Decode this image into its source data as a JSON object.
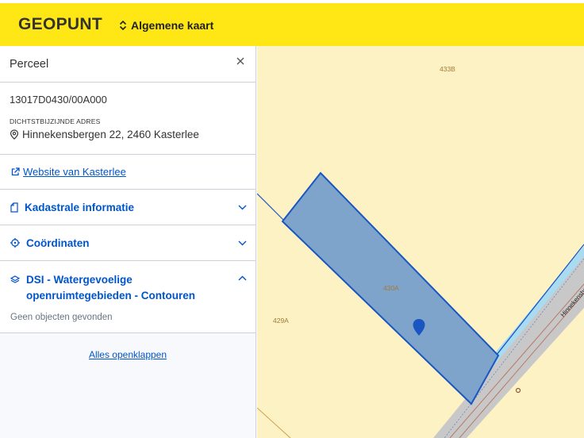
{
  "header": {
    "logo": "GEOPUNT",
    "map_type": "Algemene kaart"
  },
  "panel": {
    "title": "Perceel",
    "parcel_id": "13017D0430/00A000",
    "address_label": "DICHTSTBIJZIJNDE ADRES",
    "address": "Hinnekensbergen 22, 2460 Kasterlee",
    "website_link": "Website van Kasterlee",
    "sections": [
      {
        "label": "Kadastrale informatie",
        "icon": "document-icon",
        "expanded": false
      },
      {
        "label": "Coördinaten",
        "icon": "crosshair-icon",
        "expanded": false
      },
      {
        "label": "DSI - Watergevoelige openruimtegebieden - Contouren",
        "icon": "layers-icon",
        "expanded": true
      }
    ],
    "empty_message": "Geen objecten gevonden",
    "expand_all": "Alles openklappen"
  },
  "map": {
    "labels": {
      "top": "433B",
      "selected": "430A",
      "left": "429A"
    },
    "street": "Hinnekensbergen",
    "colors": {
      "background": "#fdf2c4",
      "parcel_fill": "#7ea4cb",
      "parcel_stroke": "#1a56c2",
      "marker": "#1a56c2"
    }
  },
  "colors": {
    "accent": "#ffe615",
    "link": "#0055cc"
  }
}
